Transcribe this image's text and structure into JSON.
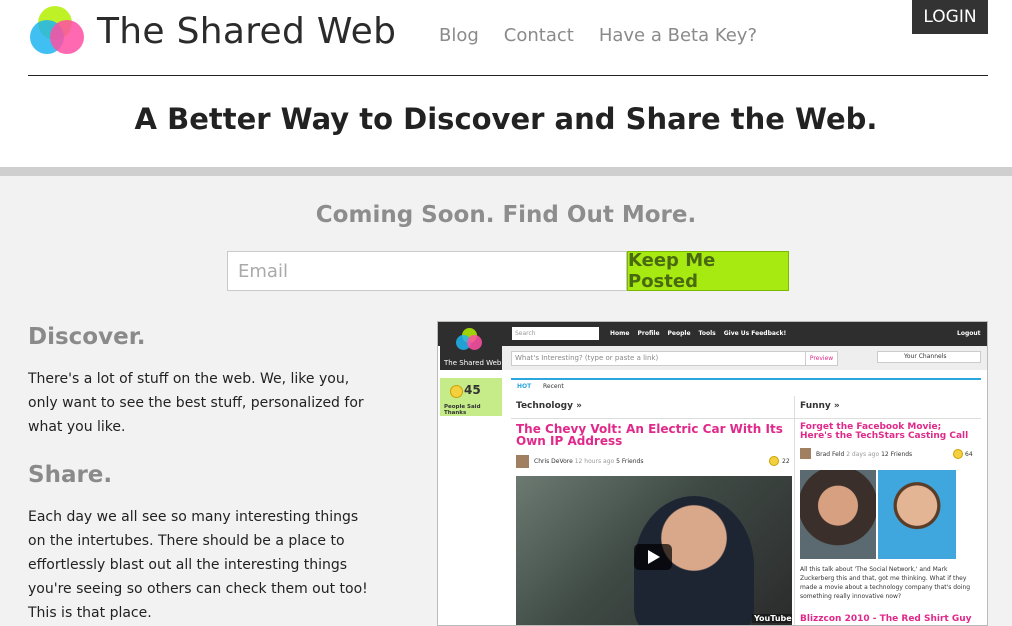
{
  "header": {
    "site_title": "The Shared Web",
    "nav": [
      "Blog",
      "Contact",
      "Have a Beta Key?"
    ],
    "login": "LOGIN",
    "tagline": "A Better Way to Discover and Share the Web."
  },
  "signup": {
    "heading": "Coming Soon. Find Out More.",
    "email_placeholder": "Email",
    "button": "Keep Me Posted"
  },
  "sections": [
    {
      "title": "Discover.",
      "body": "There's a lot of stuff on the web. We, like you, only want to see the best stuff, personalized for what you like."
    },
    {
      "title": "Share.",
      "body": "Each day we all see so many interesting things on the intertubes. There should be a place to effortlessly blast out all the interesting things you're seeing so others can check them out too! This is that place."
    }
  ],
  "preview": {
    "logo_text": "The Shared Web",
    "search_placeholder": "Search",
    "nav": [
      "Home",
      "Profile",
      "People",
      "Tools",
      "Give Us Feedback!"
    ],
    "logout": "Logout",
    "input_placeholder": "What's Interesting? (type or paste a link)",
    "preview_button": "Preview",
    "channels": "Your Channels",
    "people_count": "45",
    "people_label": "People Said Thanks",
    "tabs": [
      "HOT",
      "Recent"
    ],
    "columns": [
      "Technology »",
      "Funny »"
    ],
    "story1": {
      "title": "The Chevy Volt: An Electric Car With Its Own IP Address",
      "author": "Chris DeVore",
      "time": "12 hours ago",
      "friends": "5 Friends",
      "count": "22"
    },
    "story2": {
      "title": "Forget the Facebook Movie; Here's the TechStars Casting Call",
      "author": "Brad Feld",
      "time": "2 days ago",
      "friends": "12 Friends",
      "count": "64",
      "blurb": "All this talk about 'The Social Network,' and Mark Zuckerberg this and that, got me thinking. What if they made a movie about a technology company that's doing something really innovative now?"
    },
    "story3_title": "Blizzcon 2010 - The Red Shirt Guy",
    "video_badge": "YouTube"
  },
  "colors": {
    "accent_green": "#a6ea12",
    "pink": "#e0298a",
    "blue": "#2aa6e0"
  }
}
